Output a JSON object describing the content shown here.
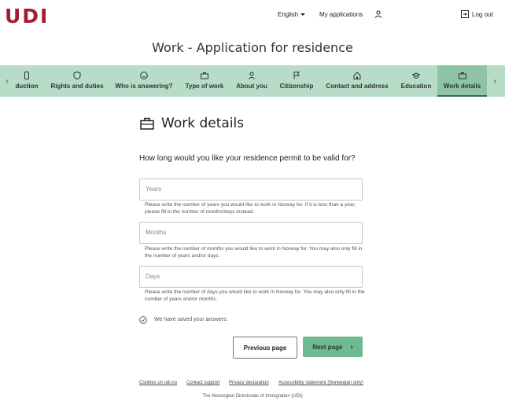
{
  "header": {
    "logo": "UDI",
    "language": "English",
    "my_applications": "My applications",
    "logout": "Log out"
  },
  "page_title": "Work - Application for residence",
  "nav": {
    "items": [
      {
        "label": "duction",
        "icon": "phone-icon"
      },
      {
        "label": "Rights and duties",
        "icon": "shield-icon"
      },
      {
        "label": "Who is answering?",
        "icon": "face-icon"
      },
      {
        "label": "Type of work",
        "icon": "briefcase-icon"
      },
      {
        "label": "About you",
        "icon": "person-icon"
      },
      {
        "label": "Citizenship",
        "icon": "flag-icon"
      },
      {
        "label": "Contact and address",
        "icon": "house-icon"
      },
      {
        "label": "Education",
        "icon": "graduation-cap-icon"
      },
      {
        "label": "Work details",
        "icon": "briefcase-icon",
        "active": true
      }
    ]
  },
  "main": {
    "section_title": "Work details",
    "question": "How long would you like your residence permit to be valid for?",
    "fields": {
      "years": {
        "placeholder": "Years",
        "hint": "Please write the number of years you would like to work in Norway for. If it is less than a year, please fill in the number of months/days instead."
      },
      "months": {
        "placeholder": "Months",
        "hint": "Please write the number of months you would like to work in Norway for. You may also only fill in the number of years and/or days."
      },
      "days": {
        "placeholder": "Days",
        "hint": "Please write the number of days you would like to work in Norway for. You may also only fill in the number of years and/or months."
      }
    },
    "saved_text": "We have saved your answers.",
    "prev_label": "Previous page",
    "next_label": "Next page"
  },
  "footer": {
    "links": [
      "Cookies on udi.no",
      "Contact support",
      "Privacy declaration",
      "Accessibility statement (Norwegian only)"
    ],
    "text": "The Norwegian Directorate of Immigration (UDI)"
  },
  "colors": {
    "brand": "#a51c30",
    "nav_bg": "#b7dcc7",
    "nav_active": "#8cc4a5",
    "primary_button": "#6fba8f"
  }
}
